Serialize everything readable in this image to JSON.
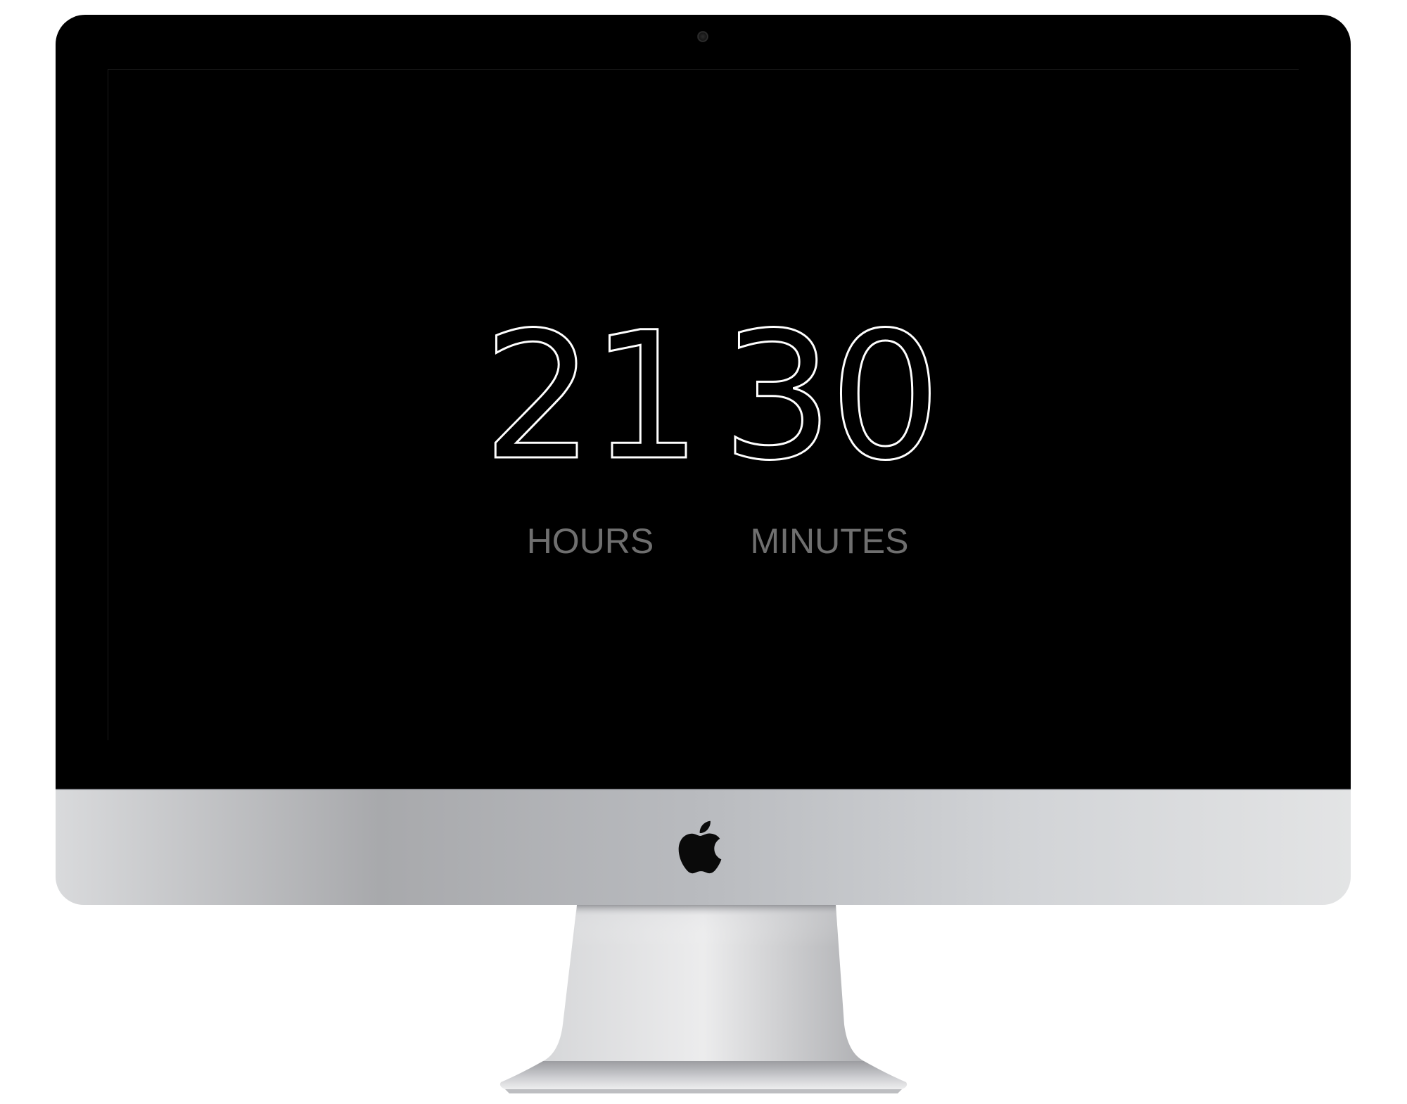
{
  "countdown": {
    "hours": {
      "value": "21",
      "label": "HOURS"
    },
    "minutes": {
      "value": "30",
      "label": "MINUTES"
    }
  },
  "device": {
    "logo_icon": "apple-logo-icon",
    "camera_icon": "camera-icon"
  },
  "colors": {
    "screen_background": "#000000",
    "number_stroke": "#ffffff",
    "label_text": "#6f6f6f",
    "bezel": "#000000",
    "chin_light": "#e3e4e5",
    "chin_dark": "#a8a9ac"
  }
}
